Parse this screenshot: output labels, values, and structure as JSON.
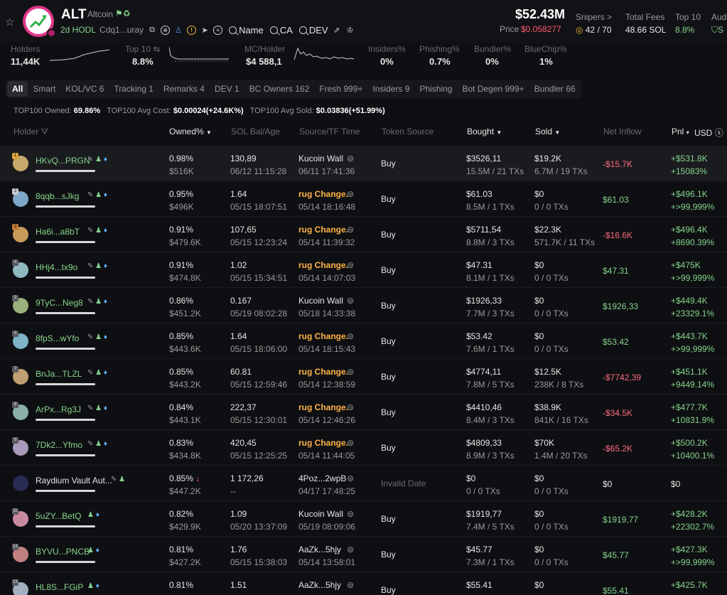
{
  "header": {
    "symbol": "ALT",
    "name": "Altcoin",
    "hodl": "2d HODL",
    "address": "Cdq1...uray",
    "search_name": "Name",
    "search_ca": "CA",
    "search_dev": "DEV",
    "market_cap": "$52.43M",
    "price_label": "Price",
    "price_value": "$0.058277",
    "snipers_label": "Snipers >",
    "snipers_value": "42 / 70",
    "fees_label": "Total Fees",
    "fees_value": "48.66 SOL",
    "top10_label": "Top 10",
    "top10_value": "8.8%",
    "audit_label": "Aud",
    "audit_value": "S"
  },
  "metrics": {
    "holders_label": "Holders",
    "holders_value": "11,44K",
    "top10_label": "Top 10",
    "top10_value": "8.8%",
    "mc_label": "MC/Holder",
    "mc_value": "$4 588,1",
    "insiders_label": "Insiders%",
    "insiders_value": "0%",
    "phishing_label": "Phishing%",
    "phishing_value": "0.7%",
    "bundler_label": "Bundler%",
    "bundler_value": "0%",
    "bluechip_label": "BlueChip%",
    "bluechip_value": "1%"
  },
  "tabs": [
    "All",
    "Smart",
    "KOL/VC 6",
    "Tracking 1",
    "Remarks 4",
    "DEV 1",
    "BC Owners 162",
    "Fresh 999+",
    "Insiders 9",
    "Phishing",
    "Bot Degen 999+",
    "Bundler 66"
  ],
  "summary": {
    "owned_label": "TOP100 Owned:",
    "owned_value": "69.86%",
    "cost_label": "TOP100 Avg Cost:",
    "cost_value": "$0.00024",
    "cost_change": "(+24.6K%)",
    "sold_label": "TOP100 Avg Sold:",
    "sold_value": "$0.03836",
    "sold_change": "(+51.99%)"
  },
  "columns": {
    "holder": "Holder",
    "owned": "Owned%",
    "sol": "SOL Bal/Age",
    "source": "Source/TF Time",
    "token_source": "Token Source",
    "bought": "Bought",
    "sold": "Sold",
    "net": "Net Inflow",
    "pnl": "Pnl",
    "usd": "USD"
  },
  "rows": [
    {
      "rank": "1",
      "name": "HKvQ...PRGN",
      "owned": "0.98%",
      "owned_usd": "$516K",
      "sol": "130,89",
      "age": "06/12 11:15:28",
      "source": "Kucoin Wall",
      "source_time": "06/11 17:41:36",
      "token_source": "Buy",
      "bought": "$3526,11",
      "bought_sub": "15.5M / 21 TXs",
      "sold": "$19.2K",
      "sold_sub": "6.7M / 19 TXs",
      "net": "-$15.7K",
      "pnl": "+$531.8K",
      "pnl_pct": "+15083%"
    },
    {
      "rank": "2",
      "name": "8qqb...sJkg",
      "owned": "0.95%",
      "owned_usd": "$496K",
      "sol": "1.64",
      "age": "05/15 18:07:51",
      "source": "rug Change.",
      "source_time": "05/14 18:16:48",
      "token_source": "Buy",
      "bought": "$61.03",
      "bought_sub": "8.5M / 1 TXs",
      "sold": "$0",
      "sold_sub": "0 / 0 TXs",
      "net": "$61.03",
      "pnl": "+$496.1K",
      "pnl_pct": "+>99,999%"
    },
    {
      "rank": "3",
      "name": "Ha6i...a8bT",
      "owned": "0.91%",
      "owned_usd": "$479.6K",
      "sol": "107,65",
      "age": "05/15 12:23:24",
      "source": "rug Change.",
      "source_time": "05/14 11:39:32",
      "token_source": "Buy",
      "bought": "$5711,54",
      "bought_sub": "8.8M / 3 TXs",
      "sold": "$22.3K",
      "sold_sub": "571.7K / 11 TXs",
      "net": "-$16.6K",
      "pnl": "+$496.4K",
      "pnl_pct": "+8690.39%"
    },
    {
      "rank": "4",
      "name": "HHj4...tx9o",
      "owned": "0.91%",
      "owned_usd": "$474.8K",
      "sol": "1.02",
      "age": "05/15 15:34:51",
      "source": "rug Change.",
      "source_time": "05/14 14:07:03",
      "token_source": "Buy",
      "bought": "$47.31",
      "bought_sub": "8.1M / 1 TXs",
      "sold": "$0",
      "sold_sub": "0 / 0 TXs",
      "net": "$47.31",
      "pnl": "+$475K",
      "pnl_pct": "+>99,999%"
    },
    {
      "rank": "5",
      "name": "9TyC...Neg8",
      "owned": "0.86%",
      "owned_usd": "$451.2K",
      "sol": "0.167",
      "age": "05/19 08:02:28",
      "source": "Kucoin Wall",
      "source_time": "05/18 14:33:38",
      "token_source": "Buy",
      "bought": "$1926,33",
      "bought_sub": "7.7M / 3 TXs",
      "sold": "$0",
      "sold_sub": "0 / 0 TXs",
      "net": "$1926,33",
      "pnl": "+$449.4K",
      "pnl_pct": "+23329.1%"
    },
    {
      "rank": "6",
      "name": "8fpS...wYfo",
      "owned": "0.85%",
      "owned_usd": "$443.6K",
      "sol": "1.64",
      "age": "05/15 18:06:00",
      "source": "rug Change.",
      "source_time": "05/14 18:15:43",
      "token_source": "Buy",
      "bought": "$53.42",
      "bought_sub": "7.6M / 1 TXs",
      "sold": "$0",
      "sold_sub": "0 / 0 TXs",
      "net": "$53.42",
      "pnl": "+$443.7K",
      "pnl_pct": "+>99,999%"
    },
    {
      "rank": "7",
      "name": "BnJa...TLZL",
      "owned": "0.85%",
      "owned_usd": "$443.2K",
      "sol": "60.81",
      "age": "05/15 12:59:46",
      "source": "rug Change.",
      "source_time": "05/14 12:38:59",
      "token_source": "Buy",
      "bought": "$4774,11",
      "bought_sub": "7.8M / 5 TXs",
      "sold": "$12.5K",
      "sold_sub": "238K / 8 TXs",
      "net": "-$7742,39",
      "pnl": "+$451.1K",
      "pnl_pct": "+9449.14%"
    },
    {
      "rank": "8",
      "name": "ArPx...Rg3J",
      "owned": "0.84%",
      "owned_usd": "$443.1K",
      "sol": "222,37",
      "age": "05/15 12:30:01",
      "source": "rug Change.",
      "source_time": "05/14 12:46:26",
      "token_source": "Buy",
      "bought": "$4410,46",
      "bought_sub": "8.4M / 3 TXs",
      "sold": "$38.9K",
      "sold_sub": "841K / 16 TXs",
      "net": "-$34.5K",
      "pnl": "+$477.7K",
      "pnl_pct": "+10831.9%"
    },
    {
      "rank": "9",
      "name": "7Dk2...Yfmo",
      "owned": "0.83%",
      "owned_usd": "$434.8K",
      "sol": "420,45",
      "age": "05/15 12:25:25",
      "source": "rug Change.",
      "source_time": "05/14 11:44:05",
      "token_source": "Buy",
      "bought": "$4809,33",
      "bought_sub": "8.9M / 3 TXs",
      "sold": "$70K",
      "sold_sub": "1.4M / 20 TXs",
      "net": "-$65.2K",
      "pnl": "+$500.2K",
      "pnl_pct": "+10400.1%"
    },
    {
      "rank": "",
      "name": "Raydium Vault Aut...",
      "owned": "0.85%",
      "owned_usd": "$447.2K",
      "sol": "1 172,26",
      "age": "--",
      "source": "4Poz...2wpB",
      "source_time": "04/17 17:48:25",
      "token_source": "Invalid Date",
      "bought": "$0",
      "bought_sub": "0 / 0 TXs",
      "sold": "$0",
      "sold_sub": "0 / 0 TXs",
      "net": "$0",
      "pnl": "$0",
      "pnl_pct": ""
    },
    {
      "rank": "11",
      "name": "5uZY...BetQ",
      "owned": "0.82%",
      "owned_usd": "$429.9K",
      "sol": "1.09",
      "age": "05/20 13:37:09",
      "source": "Kucoin Wall",
      "source_time": "05/19 08:09:06",
      "token_source": "Buy",
      "bought": "$1919,77",
      "bought_sub": "7.4M / 5 TXs",
      "sold": "$0",
      "sold_sub": "0 / 0 TXs",
      "net": "$1919,77",
      "pnl": "+$428.2K",
      "pnl_pct": "+22302.7%"
    },
    {
      "rank": "12",
      "name": "BYVU...PNCB",
      "owned": "0.81%",
      "owned_usd": "$427.2K",
      "sol": "1.76",
      "age": "05/15 15:38:03",
      "source": "AaZk...5hjy",
      "source_time": "05/14 13:58:01",
      "token_source": "Buy",
      "bought": "$45.77",
      "bought_sub": "7.3M / 1 TXs",
      "sold": "$0",
      "sold_sub": "0 / 0 TXs",
      "net": "$45.77",
      "pnl": "+$427.3K",
      "pnl_pct": "+>99,999%"
    },
    {
      "rank": "13",
      "name": "HL8S...FGiP",
      "owned": "0.81%",
      "owned_usd": "",
      "sol": "1.51",
      "age": "",
      "source": "AaZk...5hjy",
      "source_time": "",
      "token_source": "Buy",
      "bought": "$55.41",
      "bought_sub": "",
      "sold": "$0",
      "sold_sub": "",
      "net": "$55.41",
      "pnl": "+$425.7K",
      "pnl_pct": ""
    }
  ]
}
